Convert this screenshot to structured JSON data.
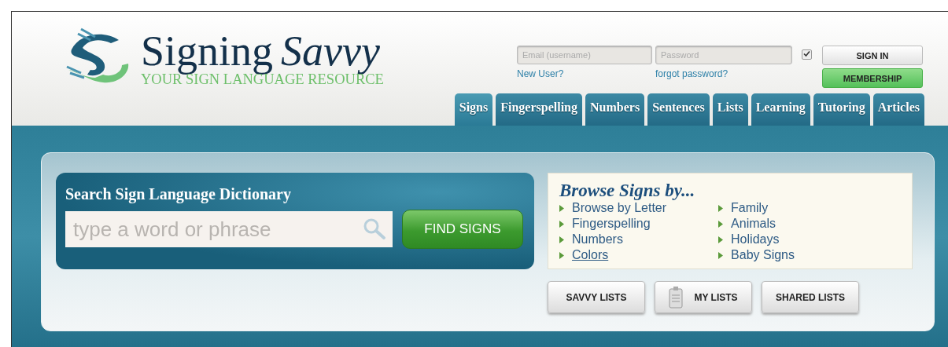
{
  "logo": {
    "name": "Signing",
    "name_script": "Savvy",
    "tagline": "YOUR SIGN LANGUAGE RESOURCE"
  },
  "login": {
    "email_placeholder": "Email (username)",
    "password_placeholder": "Password",
    "remember_checked": true,
    "new_user": "New User?",
    "forgot": "forgot password?",
    "sign_in": "SIGN IN",
    "membership": "MEMBERSHIP"
  },
  "tabs": [
    {
      "label": "Signs",
      "selected": true
    },
    {
      "label": "Fingerspelling",
      "selected": false
    },
    {
      "label": "Numbers",
      "selected": false
    },
    {
      "label": "Sentences",
      "selected": false
    },
    {
      "label": "Lists",
      "selected": false
    },
    {
      "label": "Learning",
      "selected": false
    },
    {
      "label": "Tutoring",
      "selected": false
    },
    {
      "label": "Articles",
      "selected": false
    }
  ],
  "search": {
    "title": "Search Sign Language Dictionary",
    "placeholder": "type a word or phrase",
    "button": "FIND SIGNS"
  },
  "browse": {
    "title": "Browse Signs by...",
    "columns": [
      [
        {
          "label": "Browse by Letter",
          "hovered": false
        },
        {
          "label": "Fingerspelling",
          "hovered": false
        },
        {
          "label": "Numbers",
          "hovered": false
        },
        {
          "label": "Colors",
          "hovered": true
        }
      ],
      [
        {
          "label": "Family",
          "hovered": false
        },
        {
          "label": "Animals",
          "hovered": false
        },
        {
          "label": "Holidays",
          "hovered": false
        },
        {
          "label": "Baby Signs",
          "hovered": false
        }
      ]
    ]
  },
  "list_buttons": [
    {
      "label": "SAVVY LISTS",
      "kind": "plain"
    },
    {
      "label": "MY LISTS",
      "kind": "clipboard"
    },
    {
      "label": "SHARED LISTS",
      "kind": "plain"
    }
  ]
}
